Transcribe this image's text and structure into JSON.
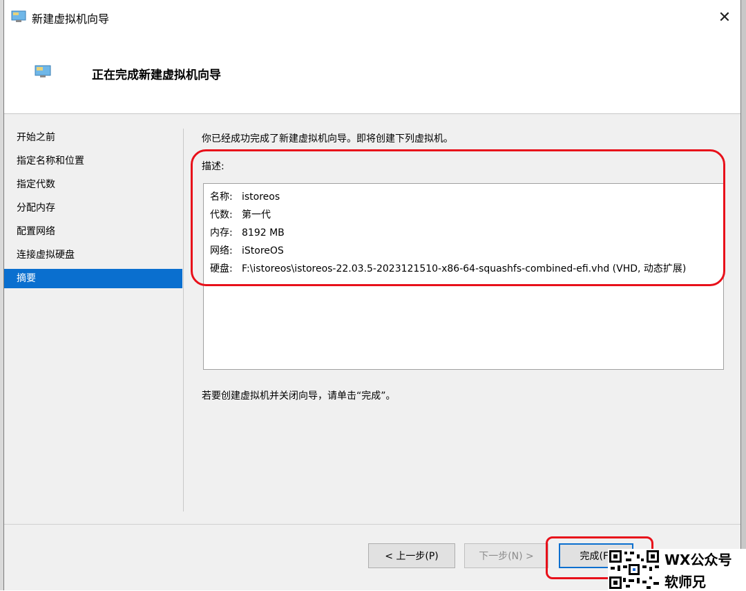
{
  "window": {
    "title": "新建虚拟机向导",
    "close_glyph": "✕"
  },
  "header": {
    "title": "正在完成新建虚拟机向导"
  },
  "sidebar": {
    "items": [
      {
        "label": "开始之前"
      },
      {
        "label": "指定名称和位置"
      },
      {
        "label": "指定代数"
      },
      {
        "label": "分配内存"
      },
      {
        "label": "配置网络"
      },
      {
        "label": "连接虚拟硬盘"
      },
      {
        "label": "摘要"
      }
    ],
    "active_index": 6
  },
  "content": {
    "intro": "你已经成功完成了新建虚拟机向导。即将创建下列虚拟机。",
    "description_label": "描述:",
    "summary": [
      {
        "label": "名称:",
        "value": "istoreos"
      },
      {
        "label": "代数:",
        "value": "第一代"
      },
      {
        "label": "内存:",
        "value": "8192 MB"
      },
      {
        "label": "网络:",
        "value": "iStoreOS"
      },
      {
        "label": "硬盘:",
        "value": "F:\\istoreos\\istoreos-22.03.5-2023121510-x86-64-squashfs-combined-efi.vhd (VHD, 动态扩展)"
      }
    ],
    "instruction": "若要创建虚拟机并关闭向导，请单击“完成”。"
  },
  "buttons": {
    "previous": "< 上一步(P)",
    "next": "下一步(N) >",
    "finish": "完成(F)"
  },
  "watermark": {
    "line1": "WX公众号",
    "line2": "软师兄"
  },
  "colors": {
    "selection": "#0a6fcf",
    "highlight": "#e8101a"
  }
}
